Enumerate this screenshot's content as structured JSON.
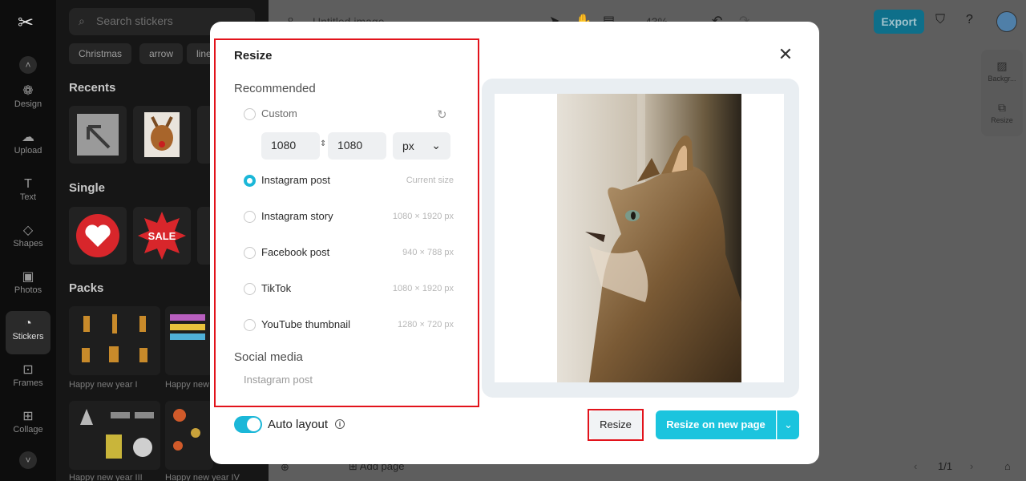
{
  "rail": {
    "items": [
      {
        "label": "Design",
        "icon": "design-icon"
      },
      {
        "label": "Upload",
        "icon": "upload-icon"
      },
      {
        "label": "Text",
        "icon": "text-icon"
      },
      {
        "label": "Shapes",
        "icon": "shapes-icon"
      },
      {
        "label": "Photos",
        "icon": "photos-icon"
      },
      {
        "label": "Stickers",
        "icon": "stickers-icon",
        "active": true
      },
      {
        "label": "Frames",
        "icon": "frames-icon"
      },
      {
        "label": "Collage",
        "icon": "collage-icon"
      }
    ]
  },
  "panel": {
    "search_placeholder": "Search stickers",
    "chips": [
      "Christmas",
      "arrow",
      "line"
    ],
    "recents_title": "Recents",
    "single_title": "Single",
    "single_sale_text": "SALE",
    "packs_title": "Packs",
    "packs": [
      "Happy new year I",
      "Happy new",
      "Happy new year III",
      "Happy new year IV"
    ]
  },
  "topbar": {
    "doc_title": "Untitled image",
    "zoom": "43%",
    "export_label": "Export"
  },
  "side_tools": [
    "Backgr...",
    "Resize"
  ],
  "bottombar": {
    "add_page": "Add page",
    "page_indicator": "1/1"
  },
  "dialog": {
    "title": "Resize",
    "recommended_label": "Recommended",
    "custom_label": "Custom",
    "width_value": "1080",
    "height_value": "1080",
    "unit": "px",
    "options": [
      {
        "label": "Instagram post",
        "size": "Current size",
        "selected": true
      },
      {
        "label": "Instagram story",
        "size": "1080 × 1920 px",
        "selected": false
      },
      {
        "label": "Facebook post",
        "size": "940 × 788 px",
        "selected": false
      },
      {
        "label": "TikTok",
        "size": "1080 × 1920 px",
        "selected": false
      },
      {
        "label": "YouTube thumbnail",
        "size": "1280 × 720 px",
        "selected": false
      }
    ],
    "social_media_label": "Social media",
    "social_media_first": "Instagram post",
    "auto_layout_label": "Auto layout",
    "auto_layout_on": true,
    "resize_button": "Resize",
    "resize_new_button": "Resize on new page",
    "colors": {
      "accent": "#1bc4de",
      "highlight": "#e2131b"
    }
  }
}
